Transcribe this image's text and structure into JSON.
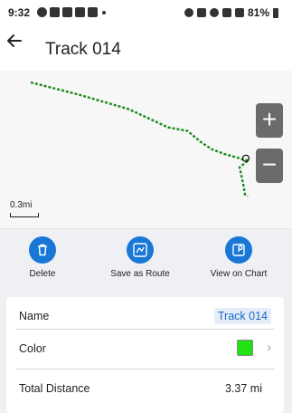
{
  "status_bar": {
    "time": "9:32",
    "battery": "81%"
  },
  "app_bar": {
    "title": "Track 014"
  },
  "map": {
    "scale_label": "0.3mi",
    "zoom_in_label": "+",
    "zoom_out_label": "−",
    "track_color": "#1a8a1a",
    "track_points": [
      [
        0,
        0
      ],
      [
        0.22,
        0.1
      ],
      [
        0.45,
        0.22
      ],
      [
        0.63,
        0.37
      ],
      [
        0.72,
        0.4
      ],
      [
        0.78,
        0.49
      ],
      [
        0.83,
        0.55
      ],
      [
        0.89,
        0.59
      ],
      [
        0.95,
        0.62
      ],
      [
        0.98,
        0.64
      ],
      [
        1.0,
        0.64
      ]
    ]
  },
  "actions": [
    {
      "label": "Delete",
      "icon": "trash-icon"
    },
    {
      "label": "Save as Route",
      "icon": "route-save-icon"
    },
    {
      "label": "View on Chart",
      "icon": "chart-icon"
    }
  ],
  "details": {
    "name_label": "Name",
    "name_value": "Track 014",
    "color_label": "Color",
    "color_value": "#22e214",
    "distance_label": "Total Distance",
    "distance_value": "3.37 mi"
  }
}
